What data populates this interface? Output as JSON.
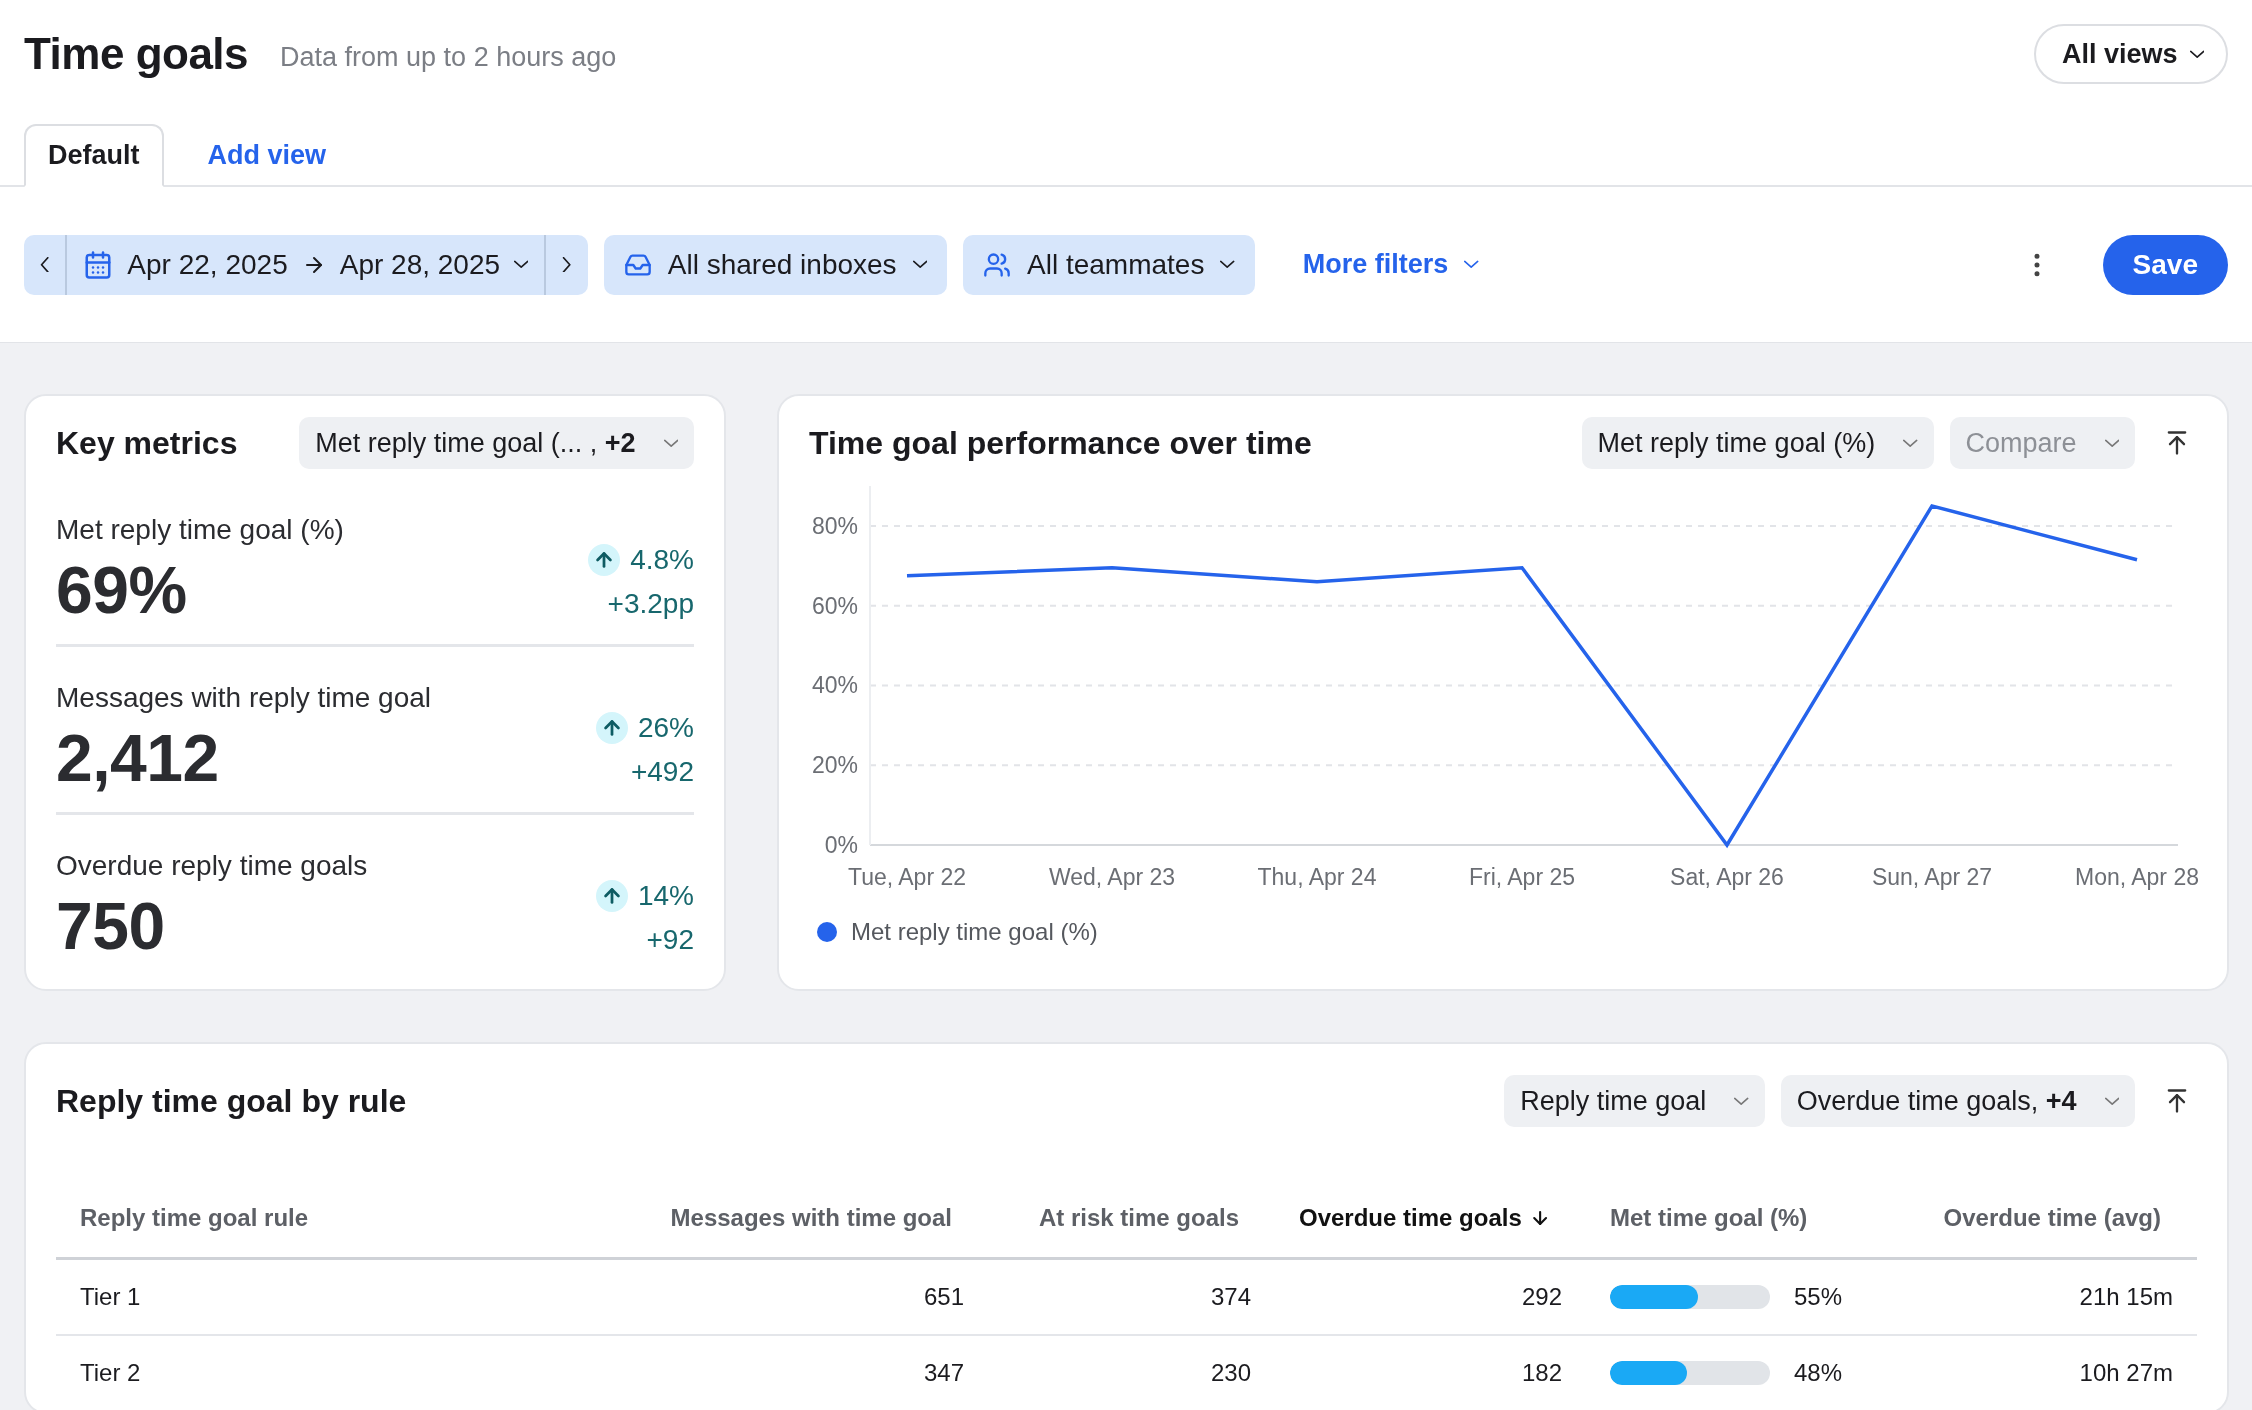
{
  "page": {
    "title": "Time goals",
    "subtitle": "Data from up to 2 hours ago",
    "views_button": "All views"
  },
  "tabs": [
    {
      "label": "Default",
      "selected": true
    },
    {
      "label": "Add view",
      "selected": false
    }
  ],
  "filters": {
    "date_from": "Apr 22, 2025",
    "date_to": "Apr 28, 2025",
    "inboxes": "All shared inboxes",
    "teammates": "All teammates",
    "more_filters": "More filters",
    "save": "Save"
  },
  "key_metrics": {
    "title": "Key metrics",
    "selector": "Met reply time goal (... , **+2**",
    "metrics": [
      {
        "label": "Met reply time goal (%)",
        "value": "69%",
        "change": "4.8%",
        "delta": "+3.2pp"
      },
      {
        "label": "Messages with reply time goal",
        "value": "2,412",
        "change": "26%",
        "delta": "+492"
      },
      {
        "label": "Overdue reply time goals",
        "value": "750",
        "change": "14%",
        "delta": "+92"
      }
    ]
  },
  "performance": {
    "title": "Time goal performance over time",
    "metric_select": "Met reply time goal (%)",
    "compare_select": {
      "label": "Compare",
      "disabled": true
    },
    "chart_data": {
      "type": "line",
      "categories": [
        "Tue, Apr 22",
        "Wed, Apr 23",
        "Thu, Apr 24",
        "Fri, Apr 25",
        "Sat, Apr 26",
        "Sun, Apr 27",
        "Mon, Apr 28"
      ],
      "series": [
        {
          "name": "Met reply time goal (%)",
          "color": "#2563eb",
          "values": [
            67.5,
            69.5,
            66,
            69.5,
            0,
            85,
            71.5
          ]
        }
      ],
      "grid": true,
      "ylim": [
        0,
        90
      ],
      "yticks": [
        {
          "value": 0,
          "label": "0%"
        },
        {
          "value": 20,
          "label": "20%"
        },
        {
          "value": 40,
          "label": "40%"
        },
        {
          "value": 60,
          "label": "60%"
        },
        {
          "value": 80,
          "label": "80%"
        }
      ]
    }
  },
  "rule_table": {
    "title": "Reply time goal by rule",
    "group_select": "Reply time goal",
    "columns_select": "Overdue time goals, **+4**",
    "columns": [
      {
        "label": "Reply time goal rule",
        "kind": "text",
        "sorted": false
      },
      {
        "label": "Messages with time goal",
        "kind": "number",
        "sorted": false
      },
      {
        "label": "At risk time goals",
        "kind": "number",
        "sorted": false
      },
      {
        "label": "Overdue time goals",
        "kind": "number",
        "sorted": true
      },
      {
        "label": "Met time goal (%)",
        "kind": "bar",
        "sorted": false
      },
      {
        "label": "Overdue time (avg)",
        "kind": "number",
        "sorted": false
      }
    ],
    "rows": [
      {
        "cells": [
          "Tier 1",
          "651",
          "374",
          "292",
          "55%",
          "21h 15m"
        ],
        "level": 0.55
      },
      {
        "cells": [
          "Tier 2",
          "347",
          "230",
          "182",
          "48%",
          "10h 27m"
        ],
        "level": 0.48
      }
    ]
  }
}
